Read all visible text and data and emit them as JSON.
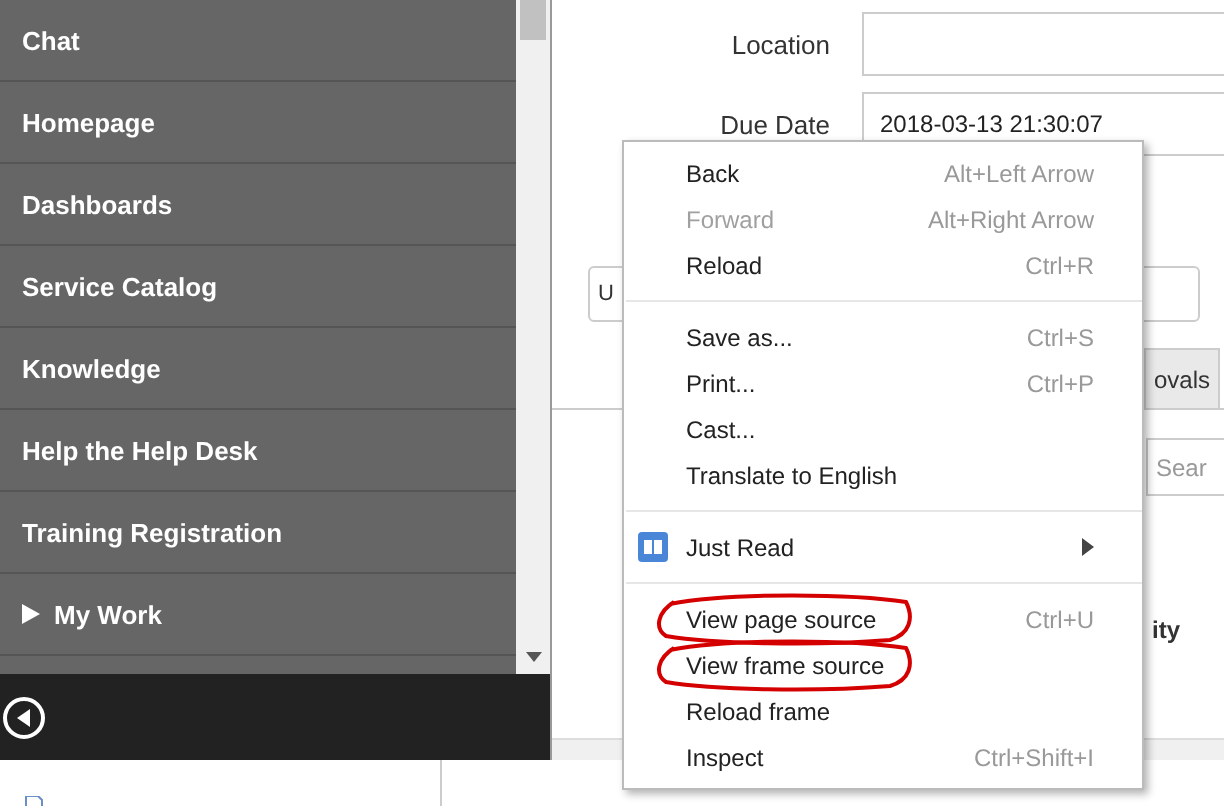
{
  "sidebar": {
    "items": [
      {
        "label": "Chat",
        "kind": "link"
      },
      {
        "label": "Homepage",
        "kind": "link"
      },
      {
        "label": "Dashboards",
        "kind": "link"
      },
      {
        "label": "Service Catalog",
        "kind": "link"
      },
      {
        "label": "Knowledge",
        "kind": "link"
      },
      {
        "label": "Help the Help Desk",
        "kind": "link"
      },
      {
        "label": "Training Registration",
        "kind": "link"
      },
      {
        "label": "My Work",
        "kind": "group",
        "expanded": false
      }
    ]
  },
  "form": {
    "fields": [
      {
        "label": "Location"
      },
      {
        "label": "Due Date",
        "value": "2018-03-13 21:30:07"
      }
    ],
    "select_fragment": "U",
    "tab_fragment": "ovals",
    "search_placeholder": "Sear",
    "column_fragment": "ity"
  },
  "context_menu": {
    "sections": [
      {
        "items": [
          {
            "label": "Back",
            "shortcut": "Alt+Left Arrow",
            "disabled": false,
            "circled": false,
            "kind": "plain"
          },
          {
            "label": "Forward",
            "shortcut": "Alt+Right Arrow",
            "disabled": true,
            "circled": false,
            "kind": "plain"
          },
          {
            "label": "Reload",
            "shortcut": "Ctrl+R",
            "disabled": false,
            "circled": false,
            "kind": "plain"
          }
        ]
      },
      {
        "items": [
          {
            "label": "Save as...",
            "shortcut": "Ctrl+S",
            "disabled": false,
            "circled": false,
            "kind": "plain"
          },
          {
            "label": "Print...",
            "shortcut": "Ctrl+P",
            "disabled": false,
            "circled": false,
            "kind": "plain"
          },
          {
            "label": "Cast...",
            "disabled": false,
            "circled": false,
            "kind": "plain"
          },
          {
            "label": "Translate to English",
            "disabled": false,
            "circled": false,
            "kind": "plain"
          }
        ]
      },
      {
        "items": [
          {
            "label": "Just Read",
            "disabled": false,
            "circled": false,
            "kind": "extension"
          }
        ]
      },
      {
        "items": [
          {
            "label": "View page source",
            "shortcut": "Ctrl+U",
            "disabled": false,
            "circled": true,
            "kind": "plain"
          },
          {
            "label": "View frame source",
            "disabled": false,
            "circled": true,
            "kind": "plain"
          },
          {
            "label": "Reload frame",
            "disabled": false,
            "circled": false,
            "kind": "plain"
          },
          {
            "label": "Inspect",
            "shortcut": "Ctrl+Shift+I",
            "disabled": false,
            "circled": false,
            "kind": "plain"
          }
        ]
      }
    ]
  }
}
